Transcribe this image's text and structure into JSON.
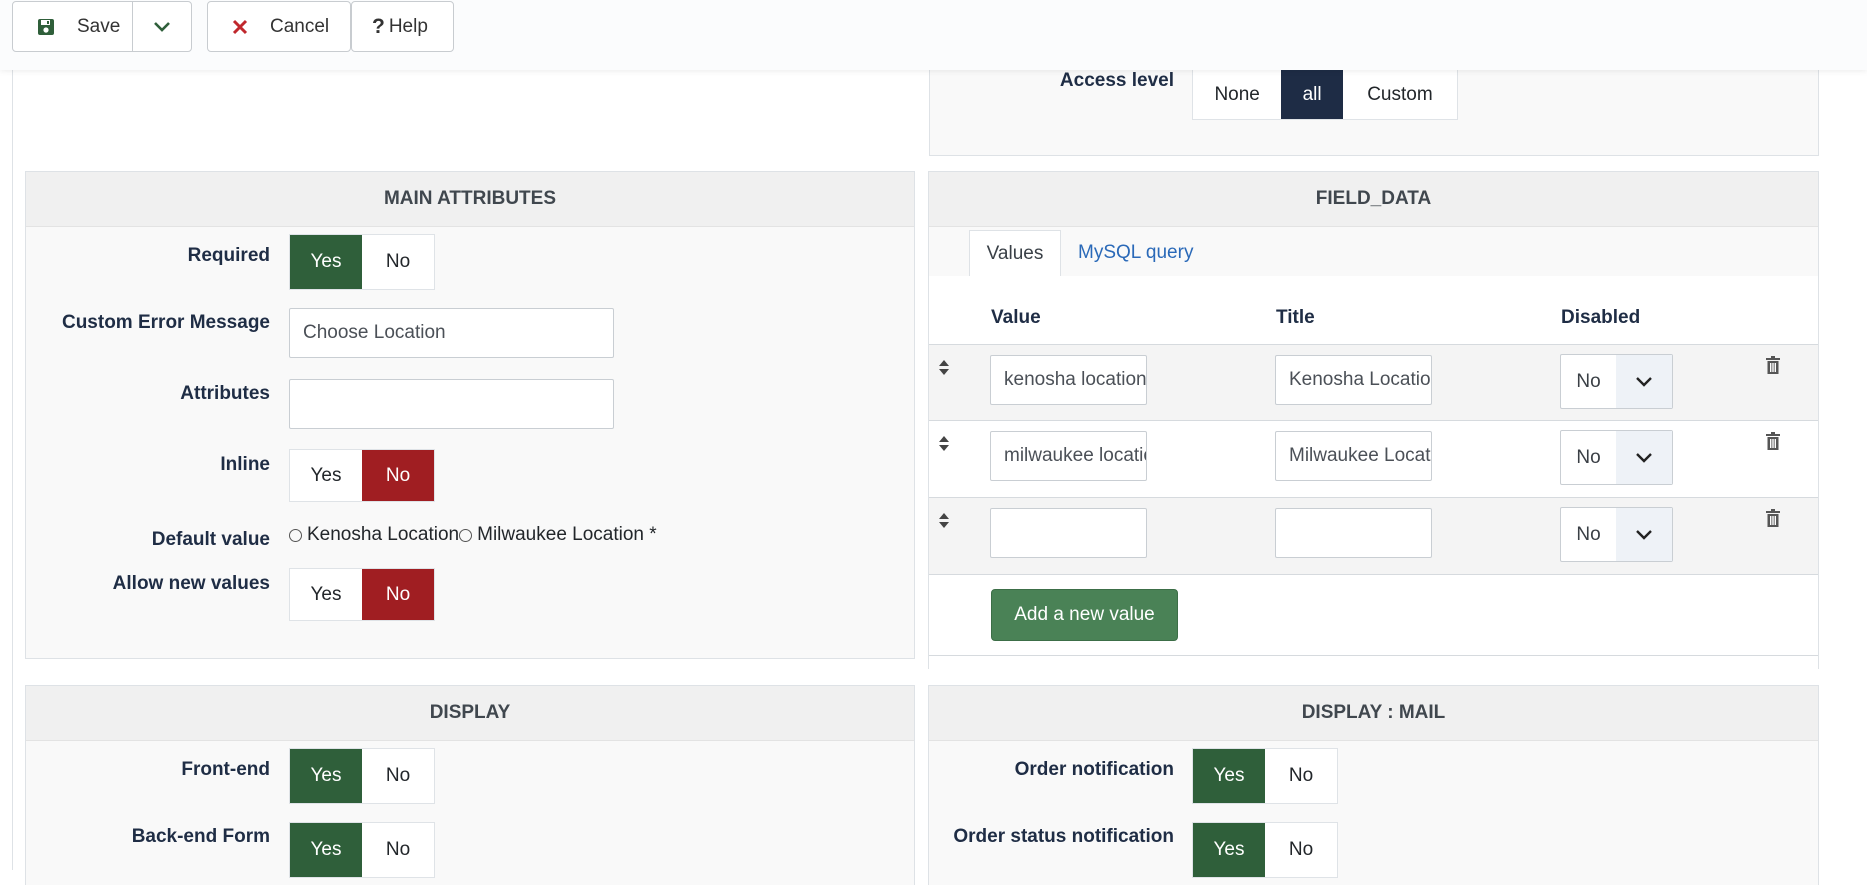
{
  "toolbar": {
    "save_label": "Save",
    "cancel_label": "Cancel",
    "help_label": "Help"
  },
  "access": {
    "label": "Access level",
    "options": [
      "None",
      "all",
      "Custom"
    ],
    "selected": "all"
  },
  "main_attributes": {
    "title": "MAIN ATTRIBUTES",
    "required": {
      "label": "Required",
      "yes": "Yes",
      "no": "No",
      "selected": "Yes"
    },
    "custom_error": {
      "label": "Custom Error Message",
      "value": "Choose Location"
    },
    "attributes": {
      "label": "Attributes",
      "value": ""
    },
    "inline": {
      "label": "Inline",
      "yes": "Yes",
      "no": "No",
      "selected": "No"
    },
    "default_value": {
      "label": "Default value",
      "options": [
        "Kenosha Location",
        "Milwaukee Location *"
      ]
    },
    "allow_new": {
      "label": "Allow new values",
      "yes": "Yes",
      "no": "No",
      "selected": "No"
    }
  },
  "field_data": {
    "title": "FIELD_DATA",
    "tabs": [
      "Values",
      "MySQL query"
    ],
    "active_tab": "Values",
    "columns": [
      "Value",
      "Title",
      "Disabled"
    ],
    "rows": [
      {
        "value": "kenosha location",
        "title": "Kenosha Location",
        "disabled": "No"
      },
      {
        "value": "milwaukee location",
        "title": "Milwaukee Location",
        "disabled": "No"
      },
      {
        "value": "",
        "title": "",
        "disabled": "No"
      }
    ],
    "add_label": "Add a new value"
  },
  "display": {
    "title": "DISPLAY",
    "frontend": {
      "label": "Front-end",
      "yes": "Yes",
      "no": "No",
      "selected": "Yes"
    },
    "backend": {
      "label": "Back-end Form",
      "yes": "Yes",
      "no": "No",
      "selected": "Yes"
    }
  },
  "display_mail": {
    "title": "DISPLAY : MAIL",
    "order_notification": {
      "label": "Order notification",
      "yes": "Yes",
      "no": "No",
      "selected": "Yes"
    },
    "order_status": {
      "label": "Order status notification",
      "yes": "Yes",
      "no": "No",
      "selected": "Yes"
    }
  },
  "colors": {
    "green": "#2f5f3a",
    "red": "#a01e22",
    "navy": "#1e2c45",
    "add_button": "#4a8256",
    "link": "#2a69b8"
  }
}
